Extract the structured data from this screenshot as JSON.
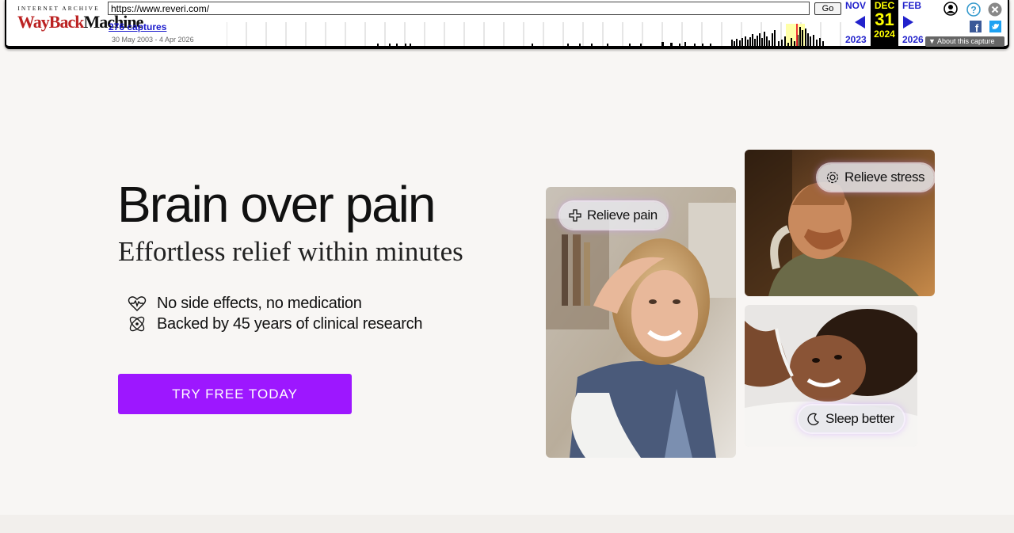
{
  "wayback": {
    "logo_top": "INTERNET ARCHIVE",
    "logo_wayback": "WayBack",
    "logo_machine": "Machine",
    "url": "https://www.reveri.com/",
    "go_label": "Go",
    "captures": "276 captures",
    "date_range": "30 May 2003 - 4 Apr 2026",
    "prev_month": "NOV",
    "prev_year": "2023",
    "current_month": "DEC",
    "current_day": "31",
    "current_year": "2024",
    "next_month": "FEB",
    "next_year": "2026",
    "about_label": "About this capture",
    "icons": [
      "user-icon",
      "help-icon",
      "close-icon",
      "facebook-icon",
      "twitter-icon"
    ],
    "colors": {
      "link": "#2222cc",
      "highlight": "#ffff00"
    }
  },
  "hero": {
    "headline": "Brain over pain",
    "subheadline": "Effortless relief within minutes",
    "features": [
      {
        "icon": "heartbeat-icon",
        "text": "No side effects, no medication"
      },
      {
        "icon": "atom-icon",
        "text": "Backed by 45 years of clinical research"
      }
    ],
    "cta_label": "TRY FREE TODAY",
    "pills": {
      "pain": "Relieve pain",
      "stress": "Relieve stress",
      "sleep": "Sleep better"
    },
    "colors": {
      "cta": "#9d17ff",
      "background": "#f8f6f4"
    }
  }
}
